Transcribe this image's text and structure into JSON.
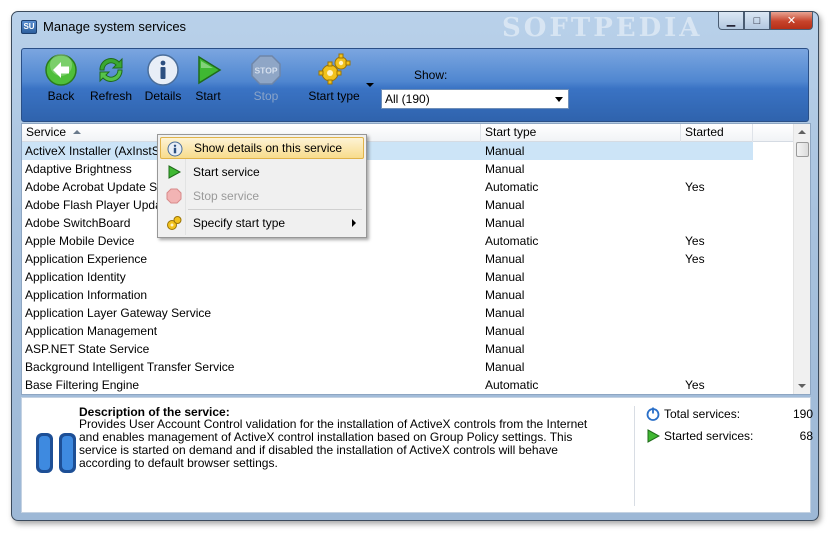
{
  "window": {
    "title": "Manage system services",
    "app_icon": "SU",
    "watermark": "SOFTPEDIA",
    "controls": {
      "minimize": "▁",
      "maximize": "□",
      "close": "✕"
    }
  },
  "toolbar": {
    "buttons": [
      {
        "label": "Back",
        "icon": "back-arrow-icon",
        "enabled": true
      },
      {
        "label": "Refresh",
        "icon": "refresh-icon",
        "enabled": true
      },
      {
        "label": "Details",
        "icon": "info-icon",
        "enabled": true
      },
      {
        "label": "Start",
        "icon": "play-icon",
        "enabled": true
      },
      {
        "label": "Stop",
        "icon": "stop-sign-icon",
        "enabled": false
      },
      {
        "label": "Start type",
        "icon": "gears-icon",
        "enabled": true
      }
    ],
    "show_label": "Show:",
    "show_value": "All (190)"
  },
  "list": {
    "columns": [
      "Service",
      "Start type",
      "Started"
    ],
    "rows": [
      {
        "service": "ActiveX Installer (AxInstSV)",
        "start_type": "Manual",
        "started": "",
        "selected": true
      },
      {
        "service": "Adaptive Brightness",
        "start_type": "Manual",
        "started": ""
      },
      {
        "service": "Adobe Acrobat Update Serv",
        "start_type": "Automatic",
        "started": "Yes"
      },
      {
        "service": "Adobe Flash Player Update",
        "start_type": "Manual",
        "started": ""
      },
      {
        "service": "Adobe SwitchBoard",
        "start_type": "Manual",
        "started": ""
      },
      {
        "service": "Apple Mobile Device",
        "start_type": "Automatic",
        "started": "Yes"
      },
      {
        "service": "Application Experience",
        "start_type": "Manual",
        "started": "Yes"
      },
      {
        "service": "Application Identity",
        "start_type": "Manual",
        "started": ""
      },
      {
        "service": "Application Information",
        "start_type": "Manual",
        "started": ""
      },
      {
        "service": "Application Layer Gateway Service",
        "start_type": "Manual",
        "started": ""
      },
      {
        "service": "Application Management",
        "start_type": "Manual",
        "started": ""
      },
      {
        "service": "ASP.NET State Service",
        "start_type": "Manual",
        "started": ""
      },
      {
        "service": "Background Intelligent Transfer Service",
        "start_type": "Manual",
        "started": ""
      },
      {
        "service": "Base Filtering Engine",
        "start_type": "Automatic",
        "started": "Yes"
      }
    ]
  },
  "context_menu": {
    "items": [
      {
        "label": "Show details on this service",
        "icon": "info-icon",
        "state": "hover"
      },
      {
        "label": "Start service",
        "icon": "play-icon",
        "state": "enabled"
      },
      {
        "label": "Stop service",
        "icon": "stop-icon",
        "state": "disabled"
      },
      {
        "label": "Specify start type",
        "icon": "gears-icon",
        "state": "enabled",
        "submenu": true
      }
    ]
  },
  "description": {
    "title": "Description of the service:",
    "text": "Provides User Account Control validation for the installation of ActiveX controls from the Internet and enables management of ActiveX control installation based on Group Policy settings. This service is started on demand and if disabled the installation of ActiveX controls will behave according to default browser settings.",
    "icon": "pause-icon"
  },
  "stats": {
    "total_label": "Total services:",
    "total_value": "190",
    "started_label": "Started services:",
    "started_value": "68"
  },
  "colors": {
    "toolbar_blue": "#3a73c4",
    "selection": "#cce4f7",
    "menu_hover": "#f8dc8c",
    "pause_icon": "#2a6fc8"
  }
}
